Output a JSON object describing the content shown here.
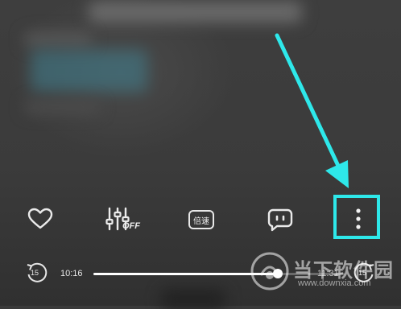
{
  "player": {
    "speed_label": "倍速",
    "equalizer_state": "OFF",
    "current_time": "10:16",
    "total_time": "11:31",
    "progress": 0.735,
    "skip_back_seconds": "15",
    "skip_forward_seconds": "15"
  },
  "icons": {
    "like": "heart-icon",
    "equalizer": "equalizer-off-icon",
    "speed": "speed-icon",
    "comment": "comment-icon",
    "more": "more-vertical-icon",
    "rewind": "rewind-15-icon",
    "forward": "forward-15-icon"
  },
  "annotation": {
    "color": "#2ee8ea"
  },
  "watermark": {
    "name": "当下软件园",
    "url": "www.downxia.com"
  }
}
